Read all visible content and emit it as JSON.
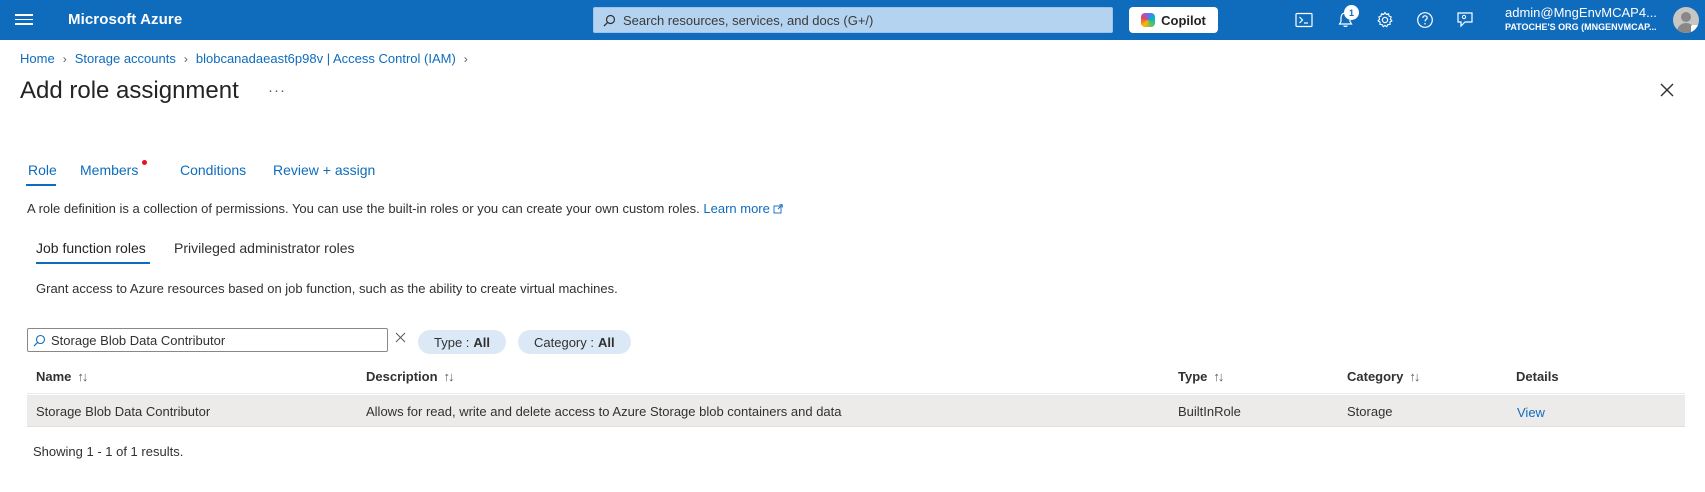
{
  "topbar": {
    "brand": "Microsoft Azure",
    "search_placeholder": "Search resources, services, and docs (G+/)",
    "copilot_label": "Copilot",
    "notification_count": "1",
    "account_name": "admin@MngEnvMCAP4...",
    "account_org": "PATOCHE'S ORG (MNGENVMCAP..."
  },
  "breadcrumb": [
    "Home",
    "Storage accounts",
    "blobcanadaeast6p98v | Access Control (IAM)"
  ],
  "page": {
    "title": "Add role assignment",
    "ellipsis": "···"
  },
  "tabs": [
    "Role",
    "Members",
    "Conditions",
    "Review + assign"
  ],
  "description": {
    "text": "A role definition is a collection of permissions. You can use the built-in roles or you can create your own custom roles.",
    "link": "Learn more"
  },
  "subtabs": [
    "Job function roles",
    "Privileged administrator roles"
  ],
  "subtab_description": "Grant access to Azure resources based on job function, such as the ability to create virtual machines.",
  "filter": {
    "value": "Storage Blob Data Contributor",
    "type_label": "Type : ",
    "type_value": "All",
    "category_label": "Category : ",
    "category_value": "All"
  },
  "table": {
    "headers": [
      "Name",
      "Description",
      "Type",
      "Category",
      "Details"
    ],
    "sort_glyph": "↑↓",
    "rows": [
      {
        "name": "Storage Blob Data Contributor",
        "description": "Allows for read, write and delete access to Azure Storage blob containers and data",
        "type": "BuiltInRole",
        "category": "Storage",
        "details": "View"
      }
    ]
  },
  "results_text": "Showing 1 - 1 of 1 results.",
  "colors": {
    "accent": "#0f6cbd",
    "topbar": "#0f6cbd",
    "required_dot": "#e81123",
    "selected_row": "#edebe9"
  }
}
